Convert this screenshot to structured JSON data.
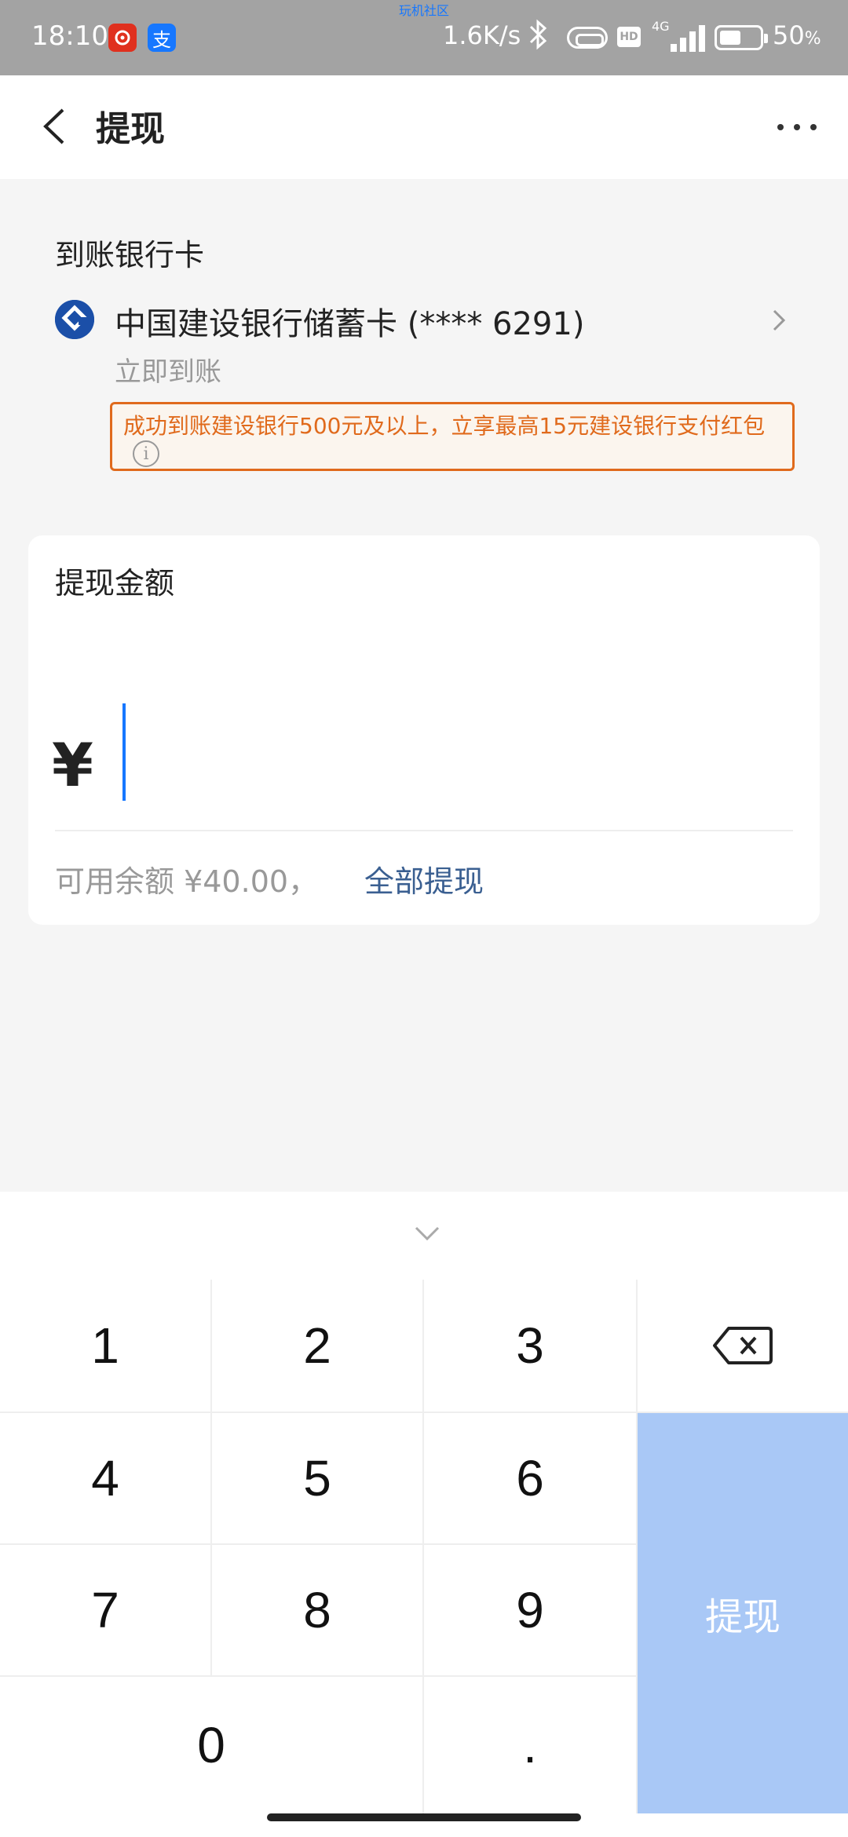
{
  "status_bar": {
    "time": "18:10",
    "center_text": "玩机社区",
    "network_speed": "1.6K/s",
    "hd_label": "HD",
    "network_type": "4G",
    "battery_percent": "50",
    "battery_unit": "%"
  },
  "header": {
    "title": "提现"
  },
  "bank_card": {
    "section_title": "到账银行卡",
    "name": "中国建设银行储蓄卡 (**** 6291)",
    "arrival": "立即到账",
    "promo": "成功到账建设银行500元及以上，立享最高15元建设银行支付红包",
    "brand_color": "#1b4fa8"
  },
  "amount": {
    "label": "提现金额",
    "currency_symbol": "¥",
    "value": "",
    "balance_text": "可用余额 ¥40.00，",
    "withdraw_all_label": "全部提现"
  },
  "keypad": {
    "keys": [
      "1",
      "2",
      "3",
      "4",
      "5",
      "6",
      "7",
      "8",
      "9",
      "0",
      "."
    ],
    "submit_label": "提现",
    "submit_color": "#a9c8f6"
  },
  "colors": {
    "accent": "#1677ff",
    "promo": "#e06a1c",
    "link": "#3a5f91"
  }
}
